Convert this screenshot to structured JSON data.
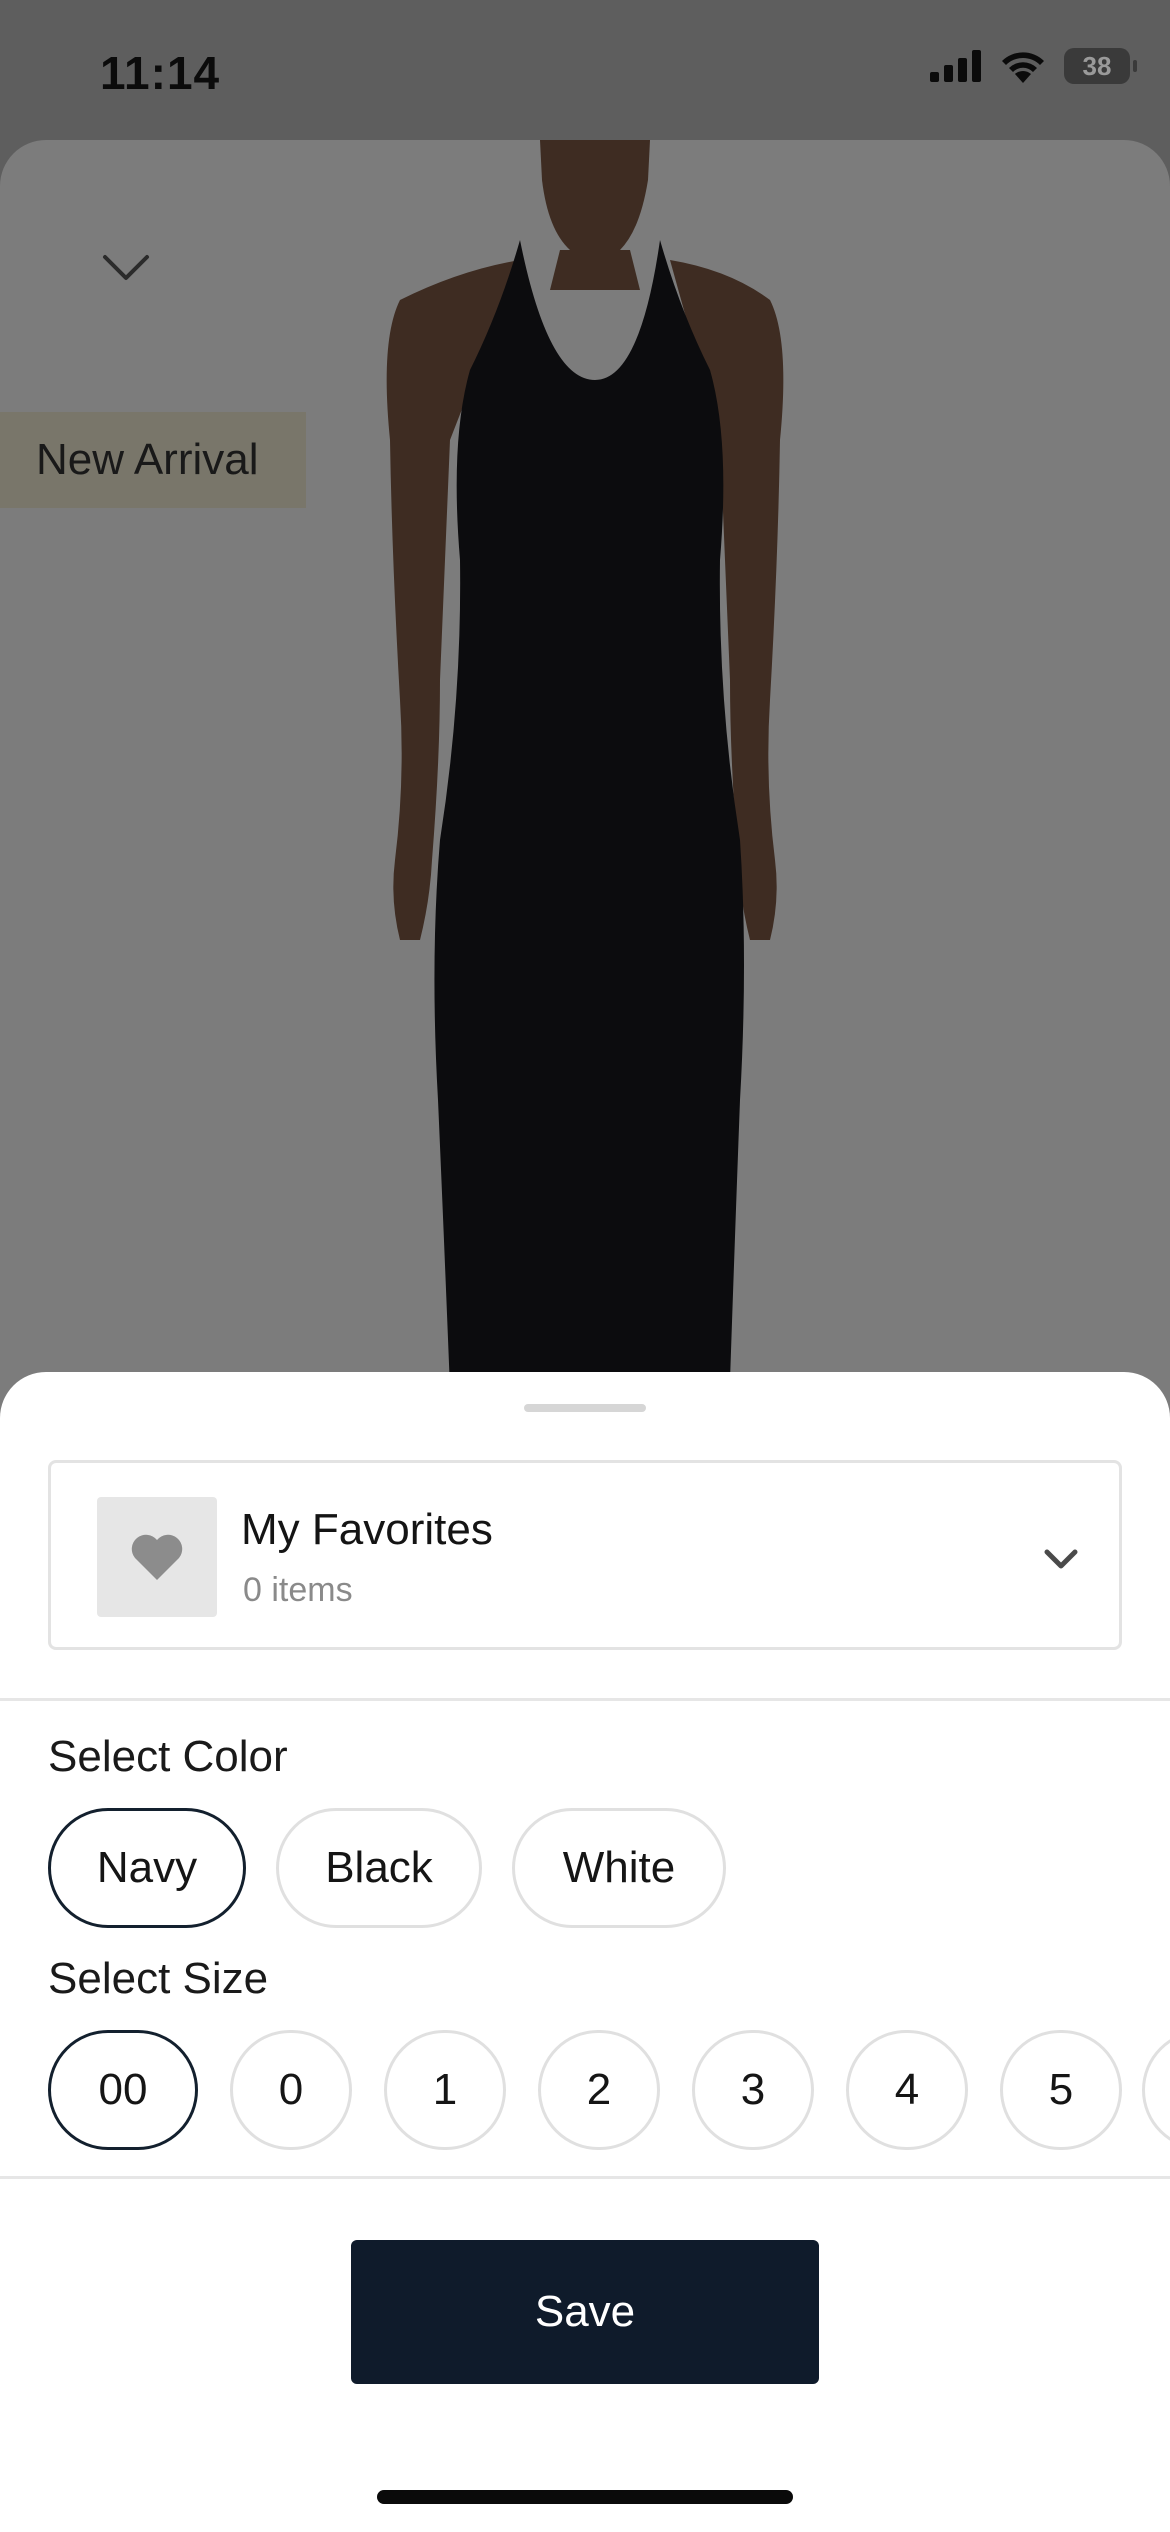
{
  "status_bar": {
    "time": "11:14",
    "battery": "38"
  },
  "product_image": {
    "badge": "New Arrival"
  },
  "save_sheet": {
    "list": {
      "name": "My Favorites",
      "count": "0 items"
    },
    "color_section": {
      "label": "Select Color",
      "options": [
        "Navy",
        "Black",
        "White"
      ],
      "selected": "Navy"
    },
    "size_section": {
      "label": "Select Size",
      "options": [
        "00",
        "0",
        "1",
        "2",
        "3",
        "4",
        "5"
      ],
      "selected": "00"
    },
    "save_label": "Save"
  },
  "colors": {
    "primary_button": "#0f1b2b",
    "selected_border": "#13202e",
    "badge_background": "#79766a"
  }
}
